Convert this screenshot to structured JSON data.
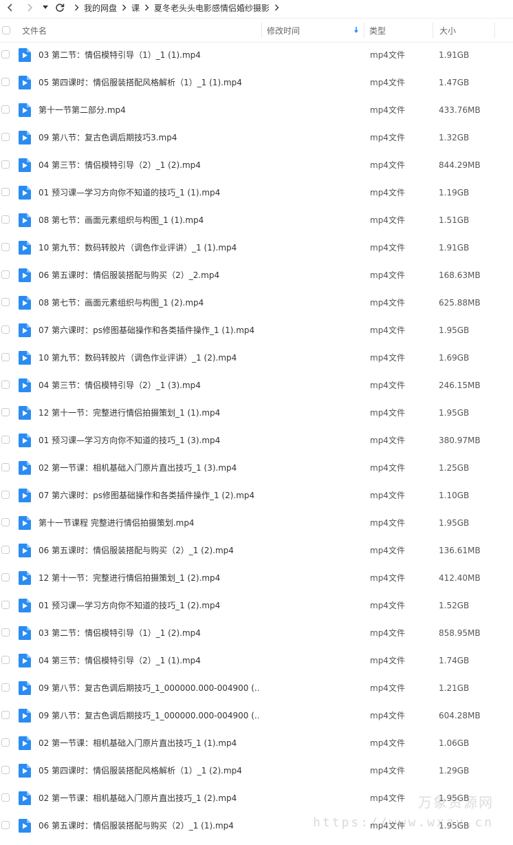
{
  "breadcrumb": {
    "items": [
      "我的网盘",
      "课",
      "夏冬老头头电影感情侣婚纱摄影"
    ]
  },
  "columns": {
    "name": "文件名",
    "modified": "修改时间",
    "type": "类型",
    "size": "大小"
  },
  "colors": {
    "file_icon": "#2a8cf3",
    "sort_arrow": "#2a8cf3"
  },
  "files": [
    {
      "name": "03  第二节：情侣模特引导（1）_1 (1).mp4",
      "type": "mp4文件",
      "size": "1.91GB"
    },
    {
      "name": "05  第四课时：情侣服装搭配风格解析（1）_1 (1).mp4",
      "type": "mp4文件",
      "size": "1.47GB"
    },
    {
      "name": "第十一节第二部分.mp4",
      "type": "mp4文件",
      "size": "433.76MB"
    },
    {
      "name": "09  第八节：复古色调后期技巧3.mp4",
      "type": "mp4文件",
      "size": "1.32GB"
    },
    {
      "name": "04  第三节：情侣模特引导（2）_1 (2).mp4",
      "type": "mp4文件",
      "size": "844.29MB"
    },
    {
      "name": "01  预习课—学习方向你不知道的技巧_1 (1).mp4",
      "type": "mp4文件",
      "size": "1.19GB"
    },
    {
      "name": "08  第七节：画面元素组织与构图_1 (1).mp4",
      "type": "mp4文件",
      "size": "1.51GB"
    },
    {
      "name": "10  第九节：数码转胶片（调色作业评讲）_1 (1).mp4",
      "type": "mp4文件",
      "size": "1.91GB"
    },
    {
      "name": "06  第五课时：情侣服装搭配与购买（2）_2.mp4",
      "type": "mp4文件",
      "size": "168.63MB"
    },
    {
      "name": "08  第七节：画面元素组织与构图_1 (2).mp4",
      "type": "mp4文件",
      "size": "625.88MB"
    },
    {
      "name": "07  第六课时：ps修图基础操作和各类插件操作_1 (1).mp4",
      "type": "mp4文件",
      "size": "1.95GB"
    },
    {
      "name": "10  第九节：数码转胶片（调色作业评讲）_1 (2).mp4",
      "type": "mp4文件",
      "size": "1.69GB"
    },
    {
      "name": "04  第三节：情侣模特引导（2）_1 (3).mp4",
      "type": "mp4文件",
      "size": "246.15MB"
    },
    {
      "name": "12  第十一节：完整进行情侣拍摄策划_1 (1).mp4",
      "type": "mp4文件",
      "size": "1.95GB"
    },
    {
      "name": "01  预习课—学习方向你不知道的技巧_1 (3).mp4",
      "type": "mp4文件",
      "size": "380.97MB"
    },
    {
      "name": "02  第一节课：相机基础入门原片直出技巧_1 (3).mp4",
      "type": "mp4文件",
      "size": "1.25GB"
    },
    {
      "name": "07  第六课时：ps修图基础操作和各类插件操作_1 (2).mp4",
      "type": "mp4文件",
      "size": "1.10GB"
    },
    {
      "name": "第十一节课程 完整进行情侣拍摄策划.mp4",
      "type": "mp4文件",
      "size": "1.95GB"
    },
    {
      "name": "06  第五课时：情侣服装搭配与购买（2）_1 (2).mp4",
      "type": "mp4文件",
      "size": "136.61MB"
    },
    {
      "name": "12  第十一节：完整进行情侣拍摄策划_1 (2).mp4",
      "type": "mp4文件",
      "size": "412.40MB"
    },
    {
      "name": "01  预习课—学习方向你不知道的技巧_1 (2).mp4",
      "type": "mp4文件",
      "size": "1.52GB"
    },
    {
      "name": "03  第二节：情侣模特引导（1）_1 (2).mp4",
      "type": "mp4文件",
      "size": "858.95MB"
    },
    {
      "name": "04  第三节：情侣模特引导（2）_1 (1).mp4",
      "type": "mp4文件",
      "size": "1.74GB"
    },
    {
      "name": "09  第八节：复古色调后期技巧_1_000000.000-004900 (...",
      "type": "mp4文件",
      "size": "1.21GB"
    },
    {
      "name": "09  第八节：复古色调后期技巧_1_000000.000-004900 (...",
      "type": "mp4文件",
      "size": "604.28MB"
    },
    {
      "name": "02  第一节课：相机基础入门原片直出技巧_1 (1).mp4",
      "type": "mp4文件",
      "size": "1.06GB"
    },
    {
      "name": "05  第四课时：情侣服装搭配风格解析（1）_1 (2).mp4",
      "type": "mp4文件",
      "size": "1.29GB"
    },
    {
      "name": "02  第一节课：相机基础入门原片直出技巧_1 (2).mp4",
      "type": "mp4文件",
      "size": "1.95GB"
    },
    {
      "name": "06  第五课时：情侣服装搭配与购买（2）_1 (1).mp4",
      "type": "mp4文件",
      "size": "1.95GB"
    }
  ],
  "watermark": {
    "text": "万象资源网",
    "url": "https://www.wxzy.cn"
  }
}
